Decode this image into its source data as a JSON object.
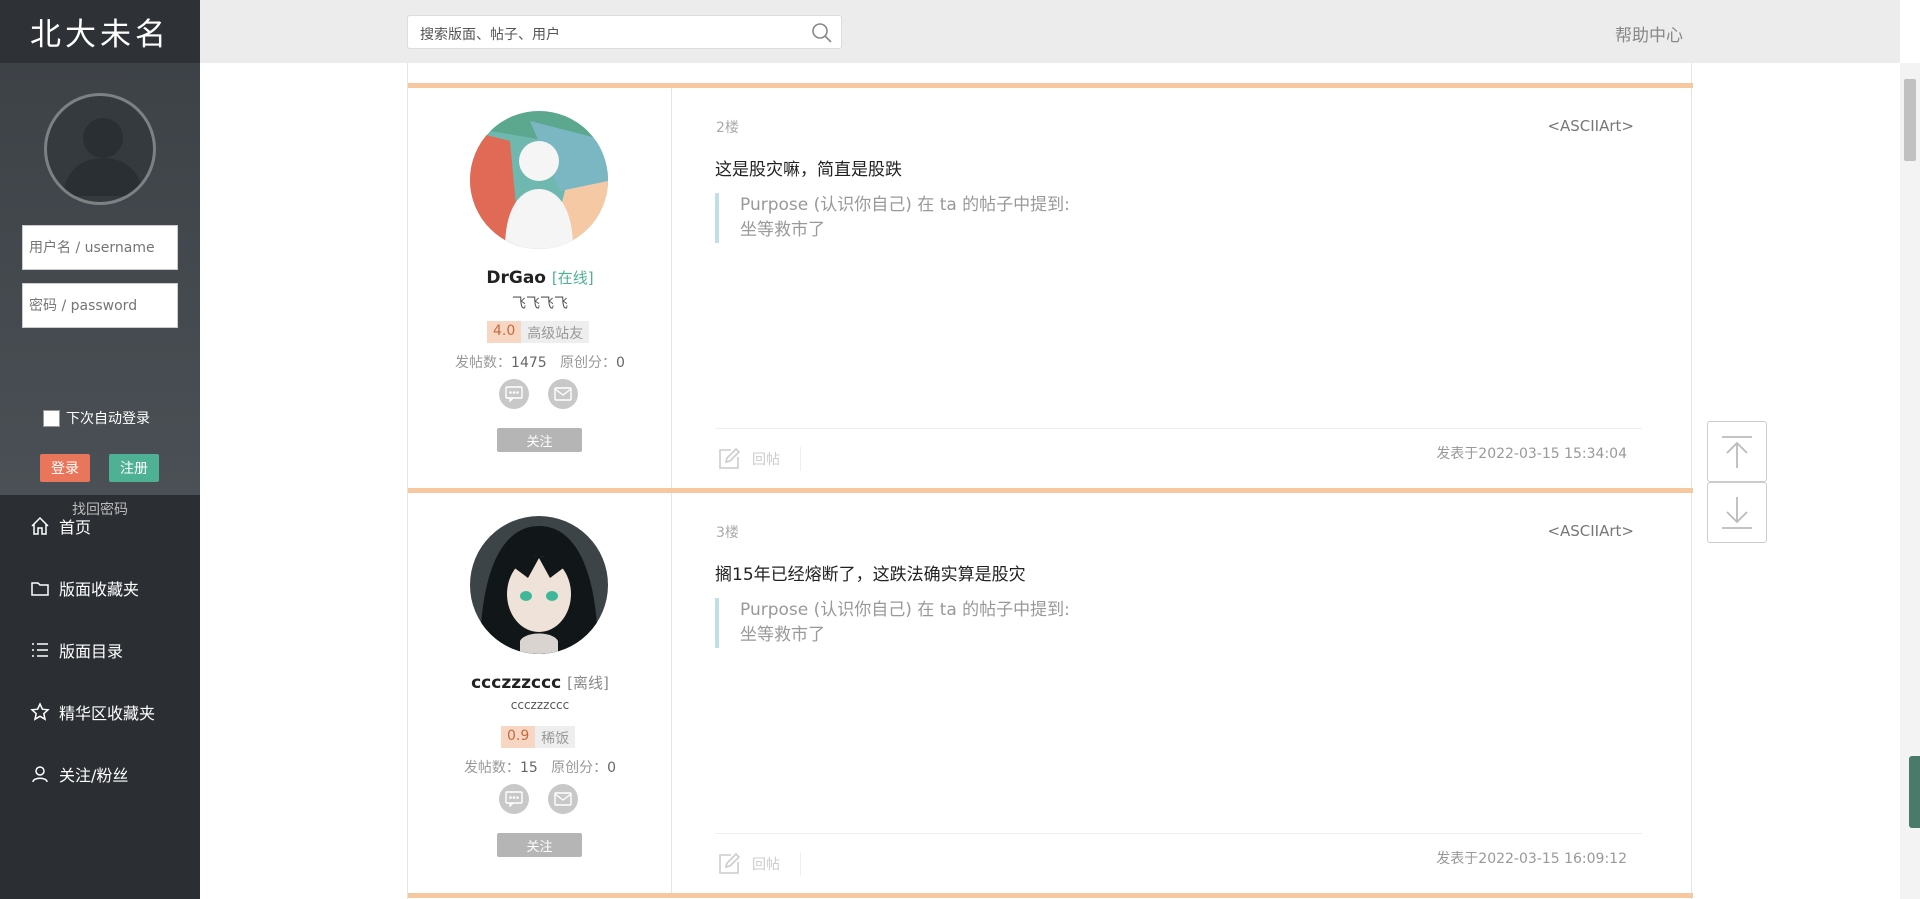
{
  "sidebar": {
    "logo": "北大未名",
    "login": {
      "username_placeholder": "用户名 / username",
      "password_placeholder": "密码 / password",
      "remember_label": "下次自动登录",
      "login_label": "登录",
      "register_label": "注册",
      "forgot_label": "找回密码"
    },
    "nav": [
      {
        "label": "首页",
        "icon": "home-icon"
      },
      {
        "label": "版面收藏夹",
        "icon": "folder-icon"
      },
      {
        "label": "版面目录",
        "icon": "list-icon"
      },
      {
        "label": "精华区收藏夹",
        "icon": "star-icon"
      },
      {
        "label": "关注/粉丝",
        "icon": "user-icon"
      }
    ]
  },
  "topbar": {
    "search_placeholder": "搜索版面、帖子、用户",
    "help_label": "帮助中心"
  },
  "posts": [
    {
      "floor": "2楼",
      "board": "<ASCIIArt>",
      "username": "DrGao",
      "status": "[在线]",
      "signature": "飞飞飞飞",
      "score": "4.0",
      "rank": "高级站友",
      "post_count_label": "发帖数：",
      "post_count": "1475",
      "original_label": "原创分：",
      "original_score": "0",
      "follow_label": "关注",
      "content": "这是股灾嘛，简直是股跌",
      "quote_header": "Purpose (认识你自己) 在 ta 的帖子中提到:",
      "quote_body": "坐等救市了",
      "reply_label": "回帖",
      "time": "发表于2022-03-15 15:34:04"
    },
    {
      "floor": "3楼",
      "board": "<ASCIIArt>",
      "username": "ccczzzccc",
      "status": "[离线]",
      "signature": "ccczzzccc",
      "score": "0.9",
      "rank": "稀饭",
      "post_count_label": "发帖数：",
      "post_count": "15",
      "original_label": "原创分：",
      "original_score": "0",
      "follow_label": "关注",
      "content": "搁15年已经熔断了，这跌法确实算是股灾",
      "quote_header": "Purpose (认识你自己) 在 ta 的帖子中提到:",
      "quote_body": "坐等救市了",
      "reply_label": "回帖",
      "time": "发表于2022-03-15 16:09:12"
    }
  ],
  "colors": {
    "sidebar_bg": "#2b2f33",
    "post_divider": "#f7c8a0",
    "online_status": "#4fb194",
    "login_button": "#e9765a",
    "register_button": "#4fb194"
  }
}
